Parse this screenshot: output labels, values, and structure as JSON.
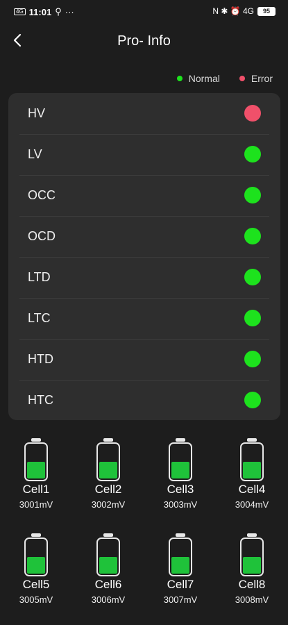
{
  "status_bar": {
    "left_signal": "4G",
    "time": "11:01",
    "right_icons": "N ✱ ⏰ 4G",
    "battery": "95"
  },
  "header": {
    "title": "Pro- Info"
  },
  "legend": {
    "normal_label": "Normal",
    "error_label": "Error",
    "normal_color": "#1de21d",
    "error_color": "#f0506a"
  },
  "status_rows": [
    {
      "label": "HV",
      "state": "error"
    },
    {
      "label": "LV",
      "state": "normal"
    },
    {
      "label": "OCC",
      "state": "normal"
    },
    {
      "label": "OCD",
      "state": "normal"
    },
    {
      "label": "LTD",
      "state": "normal"
    },
    {
      "label": "LTC",
      "state": "normal"
    },
    {
      "label": "HTD",
      "state": "normal"
    },
    {
      "label": "HTC",
      "state": "normal"
    }
  ],
  "cells": [
    {
      "name": "Cell1",
      "voltage": "3001mV"
    },
    {
      "name": "Cell2",
      "voltage": "3002mV"
    },
    {
      "name": "Cell3",
      "voltage": "3003mV"
    },
    {
      "name": "Cell4",
      "voltage": "3004mV"
    },
    {
      "name": "Cell5",
      "voltage": "3005mV"
    },
    {
      "name": "Cell6",
      "voltage": "3006mV"
    },
    {
      "name": "Cell7",
      "voltage": "3007mV"
    },
    {
      "name": "Cell8",
      "voltage": "3008mV"
    }
  ],
  "cell_fill_level": 0.5,
  "cell_fill_color": "#1fc23a"
}
